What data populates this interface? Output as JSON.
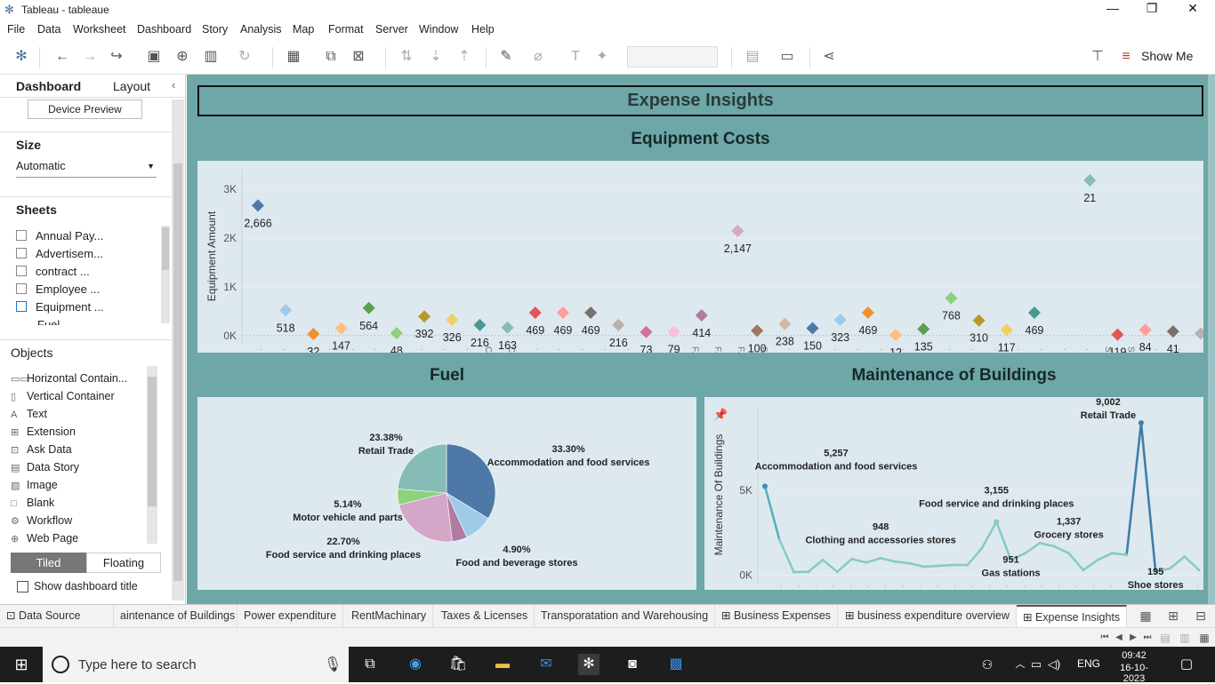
{
  "window": {
    "title": "Tableau - tableaue",
    "minimize": "—",
    "maximize": "❐",
    "close": "✕"
  },
  "menu": [
    "File",
    "Data",
    "Worksheet",
    "Dashboard",
    "Story",
    "Analysis",
    "Map",
    "Format",
    "Server",
    "Window",
    "Help"
  ],
  "toolbar": {
    "show_me": "Show Me"
  },
  "left": {
    "tab_dashboard": "Dashboard",
    "tab_layout": "Layout",
    "device_preview": "Device Preview",
    "size_label": "Size",
    "size_value": "Automatic",
    "sheets_label": "Sheets",
    "sheets": [
      "Annual Pay...",
      "Advertisem...",
      "contract ...",
      "Employee ...",
      "Equipment ...",
      "Fuel"
    ],
    "objects_label": "Objects",
    "objects": [
      {
        "icon": "horizontal-container-icon",
        "glyph": "▭▭",
        "label": "Horizontal Contain..."
      },
      {
        "icon": "vertical-container-icon",
        "glyph": "▯",
        "label": "Vertical Container"
      },
      {
        "icon": "text-icon",
        "glyph": "A",
        "label": "Text"
      },
      {
        "icon": "extension-icon",
        "glyph": "⊞",
        "label": "Extension"
      },
      {
        "icon": "ask-data-icon",
        "glyph": "⊡",
        "label": "Ask Data"
      },
      {
        "icon": "data-story-icon",
        "glyph": "▤",
        "label": "Data Story"
      },
      {
        "icon": "image-icon",
        "glyph": "▨",
        "label": "Image"
      },
      {
        "icon": "blank-icon",
        "glyph": "□",
        "label": "Blank"
      },
      {
        "icon": "workflow-icon",
        "glyph": "⚙",
        "label": "Workflow"
      },
      {
        "icon": "web-page-icon",
        "glyph": "⊕",
        "label": "Web Page"
      }
    ],
    "tiled": "Tiled",
    "floating": "Floating",
    "show_title": "Show dashboard title"
  },
  "dashboard": {
    "title": "Expense Insights",
    "equipment_title": "Equipment Costs",
    "fuel_title": "Fuel",
    "maintenance_title": "Maintenance of Buildings"
  },
  "chart_data": [
    {
      "type": "scatter",
      "title": "Equipment Costs",
      "ylabel": "Equipment Amount",
      "yticks": [
        "0K",
        "1K",
        "2K",
        "3K"
      ],
      "ylim": [
        -150,
        3400
      ],
      "xtick_marks": [
        "",
        "",
        "",
        "",
        "",
        "",
        "",
        "",
        "",
        "",
        "C..",
        "C..",
        "",
        "",
        "",
        "",
        "",
        "",
        "",
        "F..",
        "F..",
        "F..",
        "F..",
        "",
        "",
        "",
        "",
        "",
        "",
        "",
        "",
        "",
        "",
        "",
        "",
        "",
        "",
        "S..",
        "S..",
        "",
        ""
      ],
      "values": [
        2666,
        518,
        32,
        147,
        564,
        48,
        392,
        326,
        216,
        163,
        469,
        469,
        469,
        216,
        73,
        79,
        414,
        null,
        100,
        238,
        150,
        323,
        469,
        12,
        135,
        768,
        310,
        117,
        469,
        null,
        3181,
        21,
        119,
        84,
        41
      ],
      "colors": [
        "#4e79a7",
        "#a0cbe8",
        "#f28e2b",
        "#ffbe7d",
        "#59a14f",
        "#8cd17d",
        "#b6992d",
        "#f1ce63",
        "#499894",
        "#86bcb6",
        "#e15759",
        "#ff9d9a",
        "#79706e",
        "#bab0ac",
        "#d37295",
        "#fabfd2",
        "#b07aa1",
        "#d4a6c8",
        "#9d7660",
        "#d7b5a6",
        "#4e79a7",
        "#a0cbe8",
        "#f28e2b",
        "#ffbe7d",
        "#59a14f",
        "#8cd17d",
        "#b6992d",
        "#f1ce63",
        "#499894",
        "#86bcb6",
        "#86bcb6",
        "#e15759",
        "#ff9d9a",
        "#79706e",
        "#bab0ac"
      ],
      "labels": [
        "2,666",
        "518",
        "32",
        "147",
        "564",
        "48",
        "392",
        "326",
        "216",
        "163",
        "469",
        "469",
        "469",
        "216",
        "73",
        "79",
        "414",
        "2,147",
        "100",
        "238",
        "150",
        "323",
        "469",
        "12",
        "135",
        "768",
        "310",
        "117",
        "469",
        "3,181",
        "21",
        "119",
        "84",
        "41"
      ],
      "extra_point": {
        "value": 2147,
        "label": "2,147",
        "color": "#d4a6c8"
      }
    },
    {
      "type": "pie",
      "title": "Fuel",
      "slices": [
        {
          "name": "Accommodation and food services",
          "pct": 33.3,
          "label": "33.30%",
          "color": "#4e79a7"
        },
        {
          "name": "Food and beverage stores",
          "pct": 9.33,
          "label": "",
          "color": "#a0cbe8"
        },
        {
          "name": "Food and beverage stores",
          "pct": 4.9,
          "label": "4.90%",
          "color": "#b07aa1"
        },
        {
          "name": "Food service and drinking places",
          "pct": 22.7,
          "label": "22.70%",
          "color": "#d4a6c8"
        },
        {
          "name": "Motor vehicle and parts",
          "pct": 5.14,
          "label": "5.14%",
          "color": "#8cd17d"
        },
        {
          "name": "Retail Trade",
          "pct": 23.38,
          "label": "23.38%",
          "color": "#86bcb6"
        }
      ],
      "annotations": [
        {
          "pct": "23.38%",
          "name": "Retail Trade"
        },
        {
          "pct": "33.30%",
          "name": "Accommodation and food services"
        },
        {
          "pct": "5.14%",
          "name": "Motor vehicle and parts"
        },
        {
          "pct": "22.70%",
          "name": "Food service and drinking places"
        },
        {
          "pct": "4.90%",
          "name": "Food and beverage stores"
        }
      ]
    },
    {
      "type": "line",
      "title": "Maintenance of Buildings",
      "ylabel": "Maintenance Of Buildings",
      "yticks": [
        "0K",
        "5K"
      ],
      "ylim": [
        -500,
        10000
      ],
      "values": [
        5257,
        2100,
        180,
        200,
        900,
        200,
        950,
        750,
        1000,
        800,
        700,
        500,
        550,
        600,
        600,
        1600,
        3155,
        900,
        1300,
        1900,
        1700,
        1300,
        300,
        900,
        1300,
        1200,
        9002,
        195,
        400,
        1100,
        300
      ],
      "annotations": [
        {
          "index": 0,
          "value": "5,257",
          "name": "Accommodation and food services"
        },
        {
          "index": 8,
          "value": "948",
          "name": "Clothing and accessories stores"
        },
        {
          "index": 16,
          "value": "3,155",
          "name": "Food service and drinking places"
        },
        {
          "index": 17,
          "value": "951",
          "name": "Gas stations"
        },
        {
          "index": 21,
          "value": "1,337",
          "name": "Grocery stores"
        },
        {
          "index": 26,
          "value": "9,002",
          "name": "Retail Trade"
        },
        {
          "index": 27,
          "value": "195",
          "name": "Shoe stores"
        }
      ],
      "line_color": "#86c9c9",
      "highlight_color": "#3f7fa6"
    }
  ],
  "sheet_tabs": [
    {
      "label": "Data Source",
      "icon": "⊡"
    },
    {
      "label": "aintenance of Buildings",
      "icon": ""
    },
    {
      "label": "Power expenditure",
      "icon": ""
    },
    {
      "label": "RentMachinary",
      "icon": ""
    },
    {
      "label": "Taxes & Licenses",
      "icon": ""
    },
    {
      "label": "Transporatation and Warehousing",
      "icon": ""
    },
    {
      "label": "Business Expenses",
      "icon": "⊞"
    },
    {
      "label": "business expenditure overview",
      "icon": "⊞"
    },
    {
      "label": "Expense Insights",
      "icon": "⊞"
    }
  ],
  "taskbar": {
    "search_placeholder": "Type here to search",
    "lang": "ENG",
    "time": "09:42",
    "date": "16-10-2023"
  }
}
